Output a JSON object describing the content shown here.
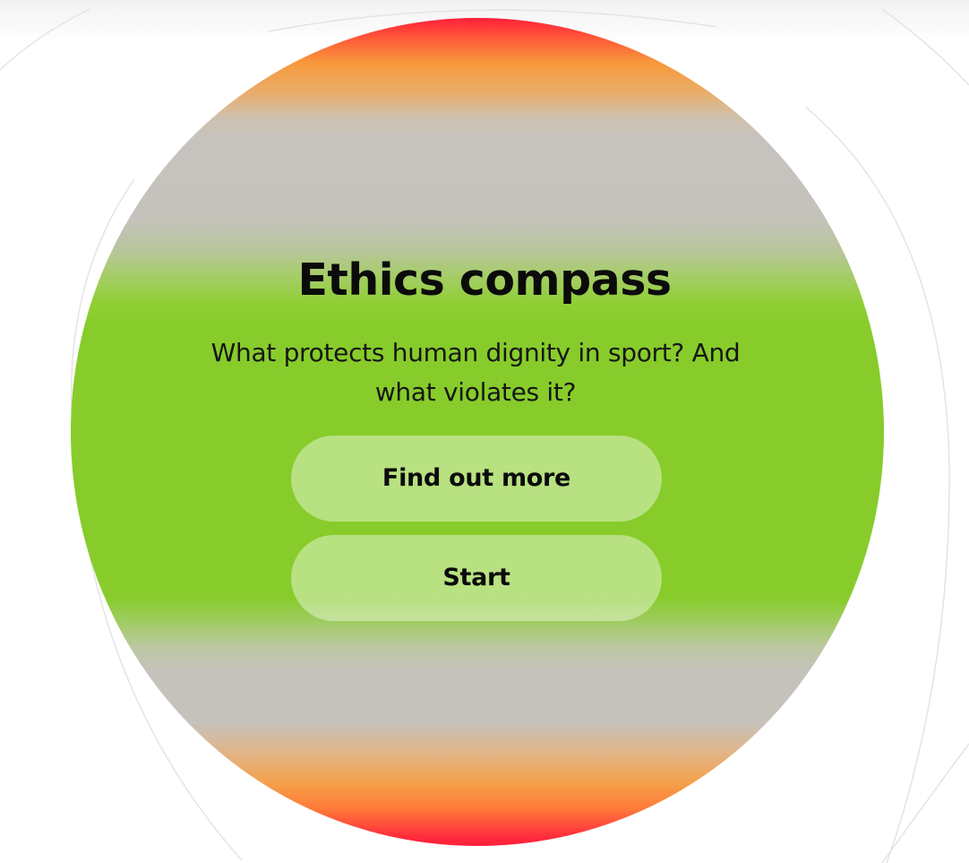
{
  "compass": {
    "title": "Ethics compass",
    "subtitle": "What protects human dignity in sport? And what violates it?"
  },
  "actions": {
    "find_out_more_label": "Find out more",
    "start_label": "Start"
  },
  "colors": {
    "center_green": "#87cc2b",
    "neutral_grey": "#c5c2bc",
    "orange": "#f79a3c",
    "red": "#ff1f3a",
    "button_fill": "rgba(245,250,235,0.45)",
    "text": "#0b0b0b"
  }
}
